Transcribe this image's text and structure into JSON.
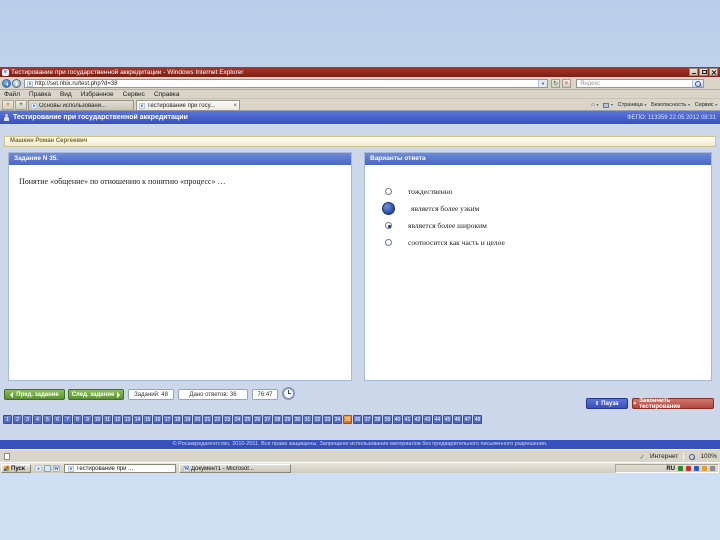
{
  "colors": {
    "titlebar_red": "#8c241a",
    "header_blue": "#3850bc",
    "panel_header_blue": "#5c7bd0",
    "body_bg": "#ccd7ea",
    "grid_cell_blue": "#5c7bd0",
    "current_cell_orange": "#e8821e",
    "green_button": "#6aa83e",
    "finish_red": "#b04840",
    "slide_bg": "#c3d7ee"
  },
  "icons": {
    "ie_logo": "e",
    "word_logo": "W",
    "refresh": "↻",
    "stop": "×",
    "dropdown": "▼",
    "star": "★",
    "plus": "+",
    "home": "⌂",
    "tab_close": "×",
    "pause": "‖",
    "finish": "×",
    "check": "✓"
  },
  "window": {
    "title": "Тестирование при государственной аккредитации - Windows Internet Explorer",
    "url": "http://set.nbix.ru/test.php?d=38",
    "search_text": "Яндекс",
    "menu": [
      "Файл",
      "Правка",
      "Вид",
      "Избранное",
      "Сервис",
      "Справка"
    ],
    "tabs": [
      {
        "label": "Основы использовани..."
      },
      {
        "label": "Тестирование при госу..."
      }
    ],
    "command_bar": [
      "Страница",
      "Безопасность",
      "Сервис"
    ]
  },
  "page": {
    "header": {
      "title": "Тестирование при государственной аккредитации",
      "session": "ФЕПО: 113359 22.05.2012 08:31"
    },
    "student_name": "Машкин Роман Сергеевич",
    "task_panel": {
      "header": "Задание N 35.",
      "question": "Понятие «общение» по отношению к понятию «процесс» …"
    },
    "answers_panel": {
      "header": "Варианты ответа",
      "options": [
        {
          "label": "тождественно",
          "state": "normal"
        },
        {
          "label": "является более узким",
          "state": "cursor"
        },
        {
          "label": "является более широким",
          "state": "selected"
        },
        {
          "label": "соотносится как часть и целое",
          "state": "normal"
        }
      ]
    },
    "controls": {
      "prev": "Пред. задание",
      "next": "След. задание",
      "tasks_count": "Заданий: 48",
      "answered": "Дано ответов: 36",
      "time_left": "76:47",
      "pause": "Пауза",
      "finish": "Закончить тестирование"
    },
    "question_grid": {
      "total": 48,
      "current": 35
    },
    "footer": "© Росаккредагентство, 2010-2011. Все права защищены. Запрещено использование материалов без предварительного письменного разрешения."
  },
  "status_bar": {
    "zone": "Интернет",
    "zoom": "100%"
  },
  "taskbar": {
    "start": "Пуск",
    "tasks": [
      {
        "label": "Тестирование при ..."
      },
      {
        "label": "Документ1 - Microsof..."
      }
    ],
    "tray_lang": "RU"
  }
}
